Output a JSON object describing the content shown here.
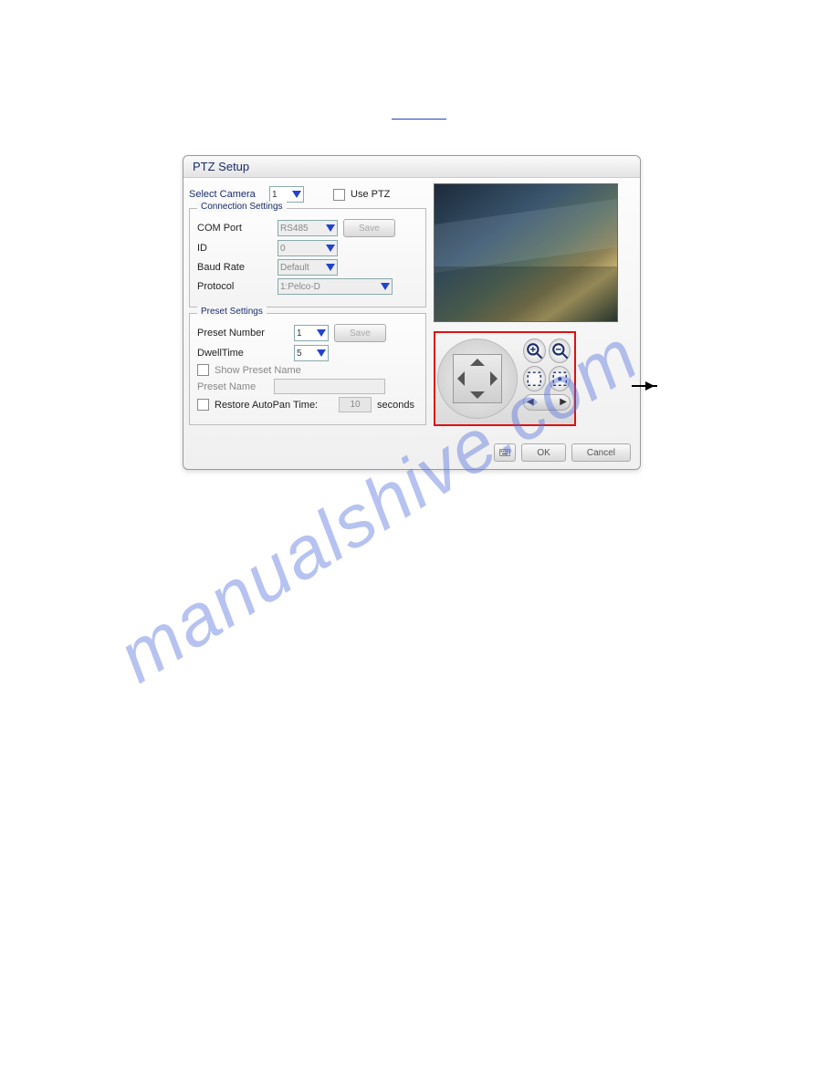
{
  "dialog": {
    "title": "PTZ Setup",
    "select_camera_label": "Select Camera",
    "select_camera_value": "1",
    "use_ptz_label": "Use PTZ"
  },
  "conn": {
    "legend": "Connection Settings",
    "com_port_label": "COM Port",
    "com_port_value": "RS485",
    "save_label": "Save",
    "id_label": "ID",
    "id_value": "0",
    "baud_label": "Baud Rate",
    "baud_value": "Default",
    "protocol_label": "Protocol",
    "protocol_value": "1:Pelco-D"
  },
  "preset": {
    "legend": "Preset Settings",
    "number_label": "Preset Number",
    "number_value": "1",
    "save_label": "Save",
    "dwell_label": "DwellTime",
    "dwell_value": "5",
    "show_name_label": "Show Preset Name",
    "name_label": "Preset Name",
    "restore_label": "Restore AutoPan Time:",
    "restore_value": "10",
    "restore_unit": "seconds"
  },
  "ptz_icons": {
    "zoom_in": "zoom-in-icon",
    "zoom_out": "zoom-out-icon",
    "focus_near": "focus-near-icon",
    "focus_far": "focus-far-icon"
  },
  "footer": {
    "ok": "OK",
    "cancel": "Cancel"
  },
  "watermark": "manualshive.com"
}
